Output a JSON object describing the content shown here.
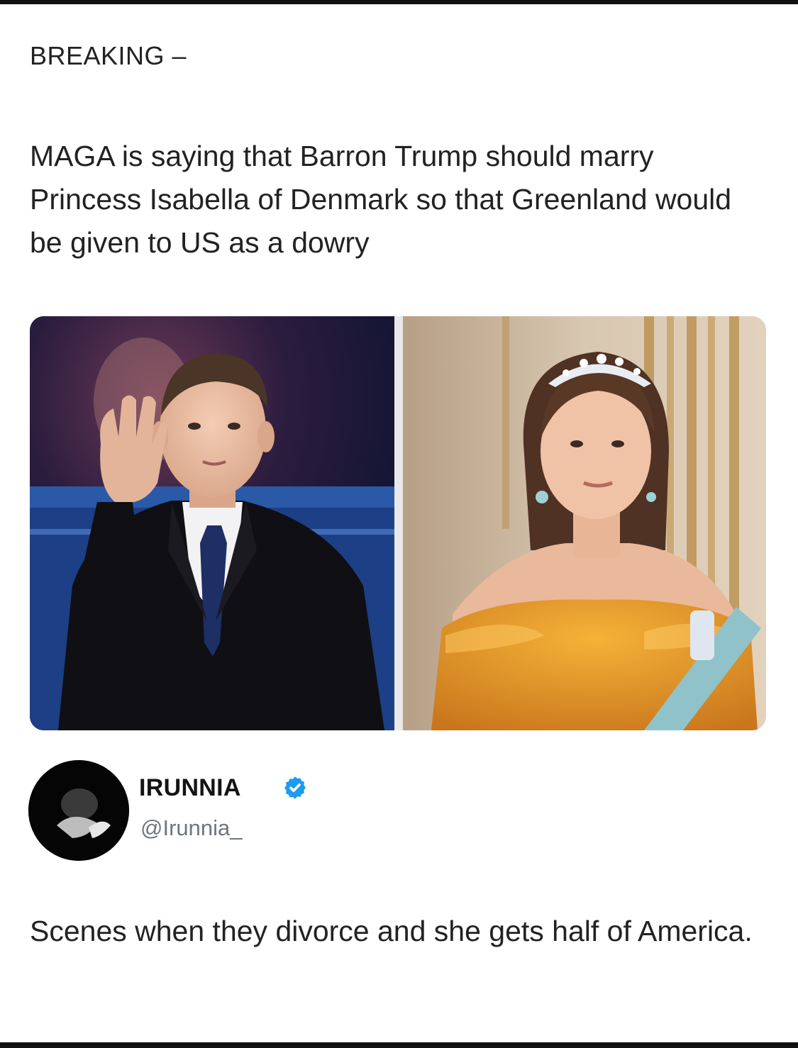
{
  "post": {
    "kicker": "BREAKING –",
    "headline": "MAGA is saying that Barron Trump should marry Princess Isabella of Denmark so that Greenland would be given to US as a dowry"
  },
  "images": {
    "left_subject": "man-in-dark-suit-photo",
    "right_subject": "woman-in-orange-gown-photo"
  },
  "reply": {
    "author_name": "IRUNNIA",
    "handle": "@Irunnia_",
    "verified": true,
    "text": "Scenes when they divorce and she gets half of America."
  },
  "colors": {
    "text": "#222222",
    "handle": "#6f767b",
    "verified": "#1d9bf0"
  }
}
